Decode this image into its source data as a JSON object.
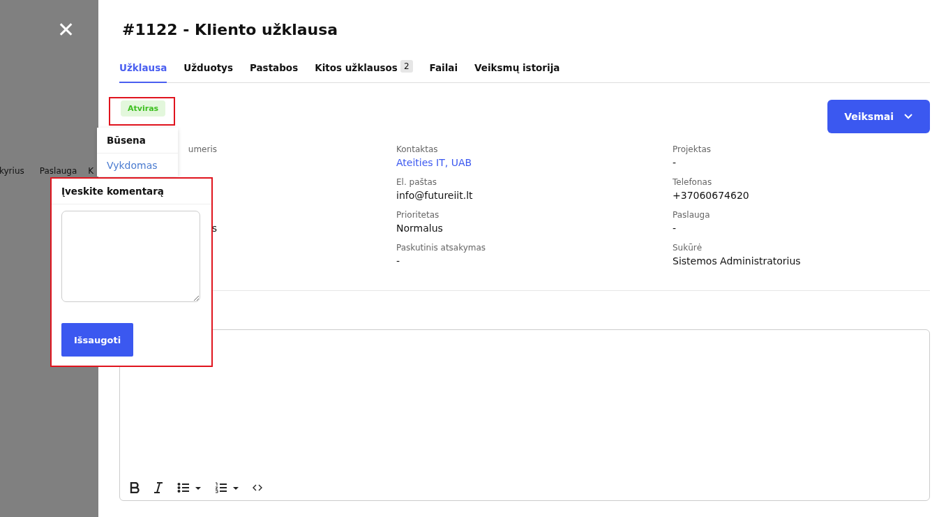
{
  "backdrop": {
    "close": "✕",
    "tabs": [
      "kyrius",
      "Paslauga",
      "K"
    ]
  },
  "title": "#1122 - Kliento užklausa",
  "tabs": [
    {
      "label": "Užklausa",
      "selected": true
    },
    {
      "label": "Užduotys",
      "selected": false
    },
    {
      "label": "Pastabos",
      "selected": false
    },
    {
      "label": "Kitos užklausos",
      "selected": false,
      "count": "2"
    },
    {
      "label": "Failai",
      "selected": false
    },
    {
      "label": "Veiksmų istorija",
      "selected": false
    }
  ],
  "status_badge": "Atviras",
  "actions_button": "Veiksmai",
  "field_columns": [
    [
      {
        "label": "umeris"
      },
      {
        "value": "s"
      }
    ],
    [
      {
        "label": "Kontaktas",
        "value": "Ateities IT, UAB",
        "kind": "link"
      },
      {
        "label": "El. paštas",
        "value": "info@futureiit.lt"
      },
      {
        "label": "Prioritetas",
        "value": "Normalus"
      },
      {
        "label": "Paskutinis atsakymas",
        "value": "-"
      }
    ],
    [
      {
        "label": "Projektas",
        "value": "-"
      },
      {
        "label": "Telefonas",
        "value": "+37060674620"
      },
      {
        "label": "Paslauga",
        "value": "-"
      },
      {
        "label": "Sukūrė",
        "value": "Sistemos Administratorius"
      }
    ]
  ],
  "status_menu": {
    "title": "Būsena",
    "items": [
      "Vykdomas"
    ]
  },
  "comment_popup": {
    "title": "Įveskite komentarą",
    "save": "Išsaugoti"
  }
}
